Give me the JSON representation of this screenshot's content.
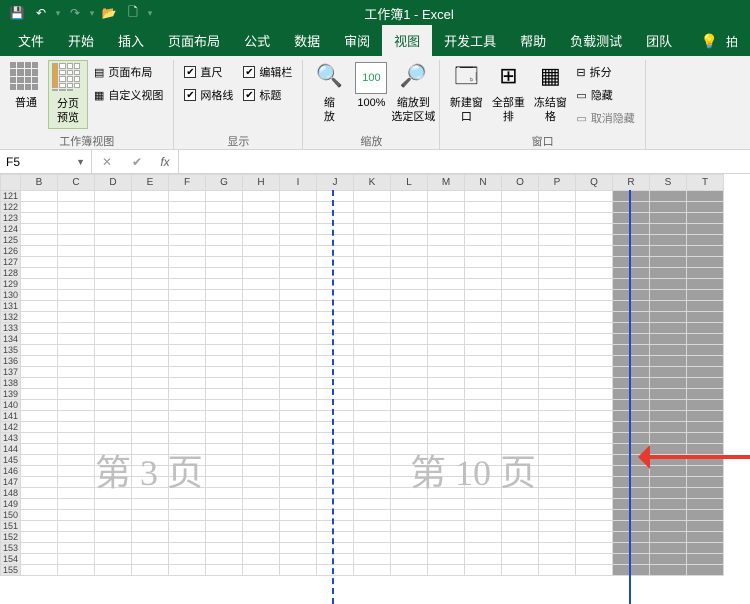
{
  "app_title": "工作簿1 - Excel",
  "tabs": {
    "file": "文件",
    "home": "开始",
    "insert": "插入",
    "layout": "页面布局",
    "formula": "公式",
    "data": "数据",
    "review": "审阅",
    "view": "视图",
    "dev": "开发工具",
    "help": "帮助",
    "load": "负载测试",
    "team": "团队"
  },
  "ribbon": {
    "view_group": {
      "normal": "普通",
      "page_break": "分页\n预览",
      "page_layout": "页面布局",
      "custom_view": "自定义视图",
      "label": "工作簿视图"
    },
    "show_group": {
      "ruler": "直尺",
      "formula_bar": "编辑栏",
      "gridlines": "网格线",
      "headings": "标题",
      "label": "显示"
    },
    "zoom_group": {
      "zoom": "缩\n放",
      "z100": "100%",
      "zoom_sel": "缩放到\n选定区域",
      "label": "缩放"
    },
    "window_group": {
      "new_win": "新建窗口",
      "arrange": "全部重排",
      "freeze": "冻结窗格",
      "split": "拆分",
      "hide": "隐藏",
      "unhide": "取消隐藏",
      "label": "窗口"
    }
  },
  "namebox": "F5",
  "columns": [
    "B",
    "C",
    "D",
    "E",
    "F",
    "G",
    "H",
    "I",
    "J",
    "K",
    "L",
    "M",
    "N",
    "O",
    "P",
    "Q",
    "R",
    "S",
    "T"
  ],
  "row_start": 121,
  "row_end": 155,
  "watermarks": {
    "left": "第 3 页",
    "right": "第 10 页"
  }
}
